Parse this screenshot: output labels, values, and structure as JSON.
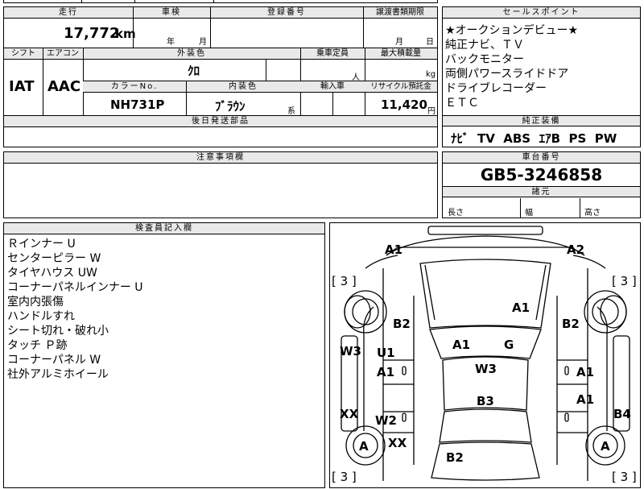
{
  "top_fragment": "四",
  "headers": {
    "mileage": "走行",
    "inspection": "車検",
    "registration": "登録番号",
    "transfer_deadline": "譲渡書類期限",
    "shift": "シフト",
    "aircon": "エアコン",
    "exterior_color": "外装色",
    "capacity": "乗車定員",
    "max_load": "最大積載量",
    "color_no": "カラーNo.",
    "interior_color": "内装色",
    "import": "輸入車",
    "recycle": "リサイクル預託金",
    "later_parts": "後日発送部品",
    "notes": "注意事項欄",
    "sales_points": "セールスポイント",
    "standard_equipment": "純正装備",
    "chassis_no": "車台番号",
    "dimensions": "諸元",
    "inspector": "検査員記入欄"
  },
  "values": {
    "mileage": "17,772",
    "mileage_unit": "km",
    "year_unit": "年",
    "month_unit": "月",
    "deadline_month": "月",
    "deadline_day": "日",
    "shift": "IAT",
    "aircon": "AAC",
    "exterior_color": "ｸﾛ",
    "capacity_unit": "人",
    "load_unit": "kg",
    "color_no": "NH731P",
    "interior_color": "ﾌﾞﾗｳﾝ",
    "interior_suffix": "系",
    "recycle": "11,420",
    "recycle_unit": "円",
    "chassis_no": "GB5-3246858",
    "length_label": "長さ",
    "width_label": "幅",
    "height_label": "高さ"
  },
  "sales_points": [
    "★オークションデビュー★",
    "純正ナビ、ＴＶ",
    "バックモニター",
    "両側パワースライドドア",
    "ドライブレコーダー",
    "ＥＴＣ"
  ],
  "equipment": [
    "ﾅﾋﾞ",
    "TV",
    "ABS",
    "ｴｱB",
    "PS",
    "PW"
  ],
  "inspector_notes": [
    "Ｒインナー U",
    "センターピラー W",
    "タイヤハウス UW",
    "コーナーパネルインナー U",
    "室内内張傷",
    "ハンドルすれ",
    "シート切れ・破れ小",
    "タッチ Ｐ跡",
    "コーナーパネル W",
    "社外アルミホイール"
  ],
  "damage_marks": {
    "front_left": "A1",
    "front_right": "A2",
    "bonnet": "A1",
    "fender_left": "B2",
    "fender_right": "B2",
    "windshield_a": "A1",
    "windshield_g": "G",
    "roof": "W3",
    "pillar_left": "W3",
    "door_fl_u": "U1",
    "door_fl_a": "A1",
    "door_fr": "A1",
    "door_rr": "A1",
    "rear_roof": "B3",
    "door_rl": "W2",
    "rocker_l": "XX",
    "rear_l": "XX",
    "quarter_r": "B4",
    "wheel_l": "A",
    "wheel_r": "A",
    "rear_bumper": "B2",
    "tire_fl": "[ 3 ]",
    "tire_fr": "[ 3 ]",
    "tire_rl": "[ 3 ]",
    "tire_rr": "[ 3 ]"
  }
}
